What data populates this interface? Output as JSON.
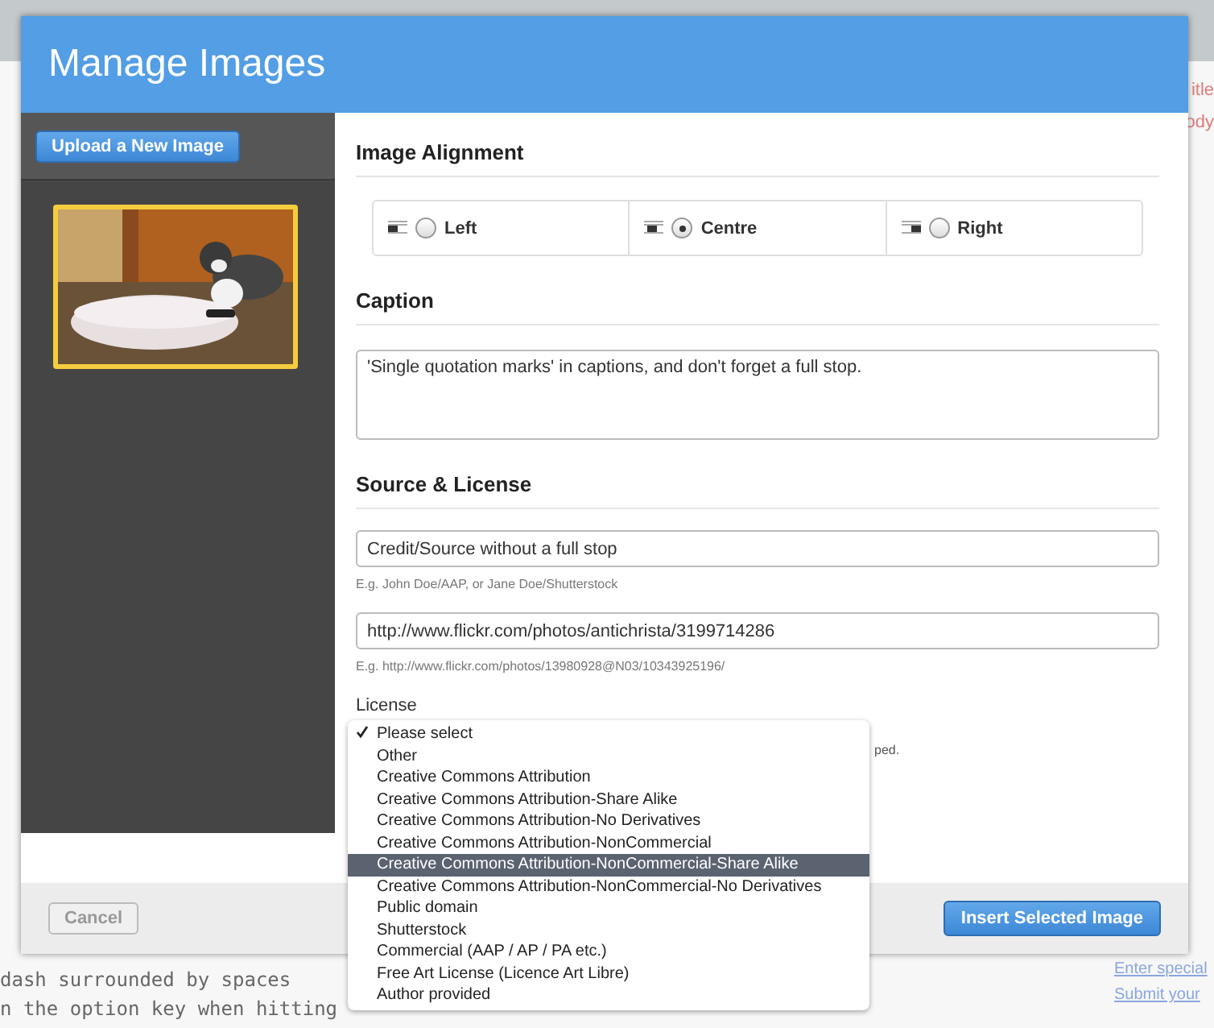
{
  "background": {
    "side_labels": [
      "itle",
      "ody"
    ],
    "lines": [
      "dash surrounded by spaces",
      "n the option key when hitting"
    ],
    "links": [
      "Enter special",
      "Submit your"
    ]
  },
  "dialog": {
    "title": "Manage Images",
    "upload_button": "Upload a New Image",
    "thumbnails": [
      {
        "kind": "picture",
        "selected": true
      }
    ],
    "alignment": {
      "heading": "Image Alignment",
      "options": [
        {
          "label": "Left",
          "kind": "left",
          "selected": false
        },
        {
          "label": "Centre",
          "kind": "centre",
          "selected": true
        },
        {
          "label": "Right",
          "kind": "right",
          "selected": false
        }
      ]
    },
    "caption": {
      "heading": "Caption",
      "value": "'Single quotation marks' in captions, and don't forget a full stop."
    },
    "source": {
      "heading": "Source & License",
      "credit": {
        "value": "Credit/Source without a full stop",
        "hint": "E.g. John Doe/AAP, or Jane Doe/Shutterstock"
      },
      "url": {
        "value": "http://www.flickr.com/photos/antichrista/3199714286",
        "hint": "E.g. http://www.flickr.com/photos/13980928@N03/10343925196/"
      },
      "license_label": "License",
      "license_hint": "ped.",
      "license_options": [
        {
          "label": "Please select",
          "checked": true,
          "highlighted": false
        },
        {
          "label": "Other",
          "checked": false,
          "highlighted": false
        },
        {
          "label": "Creative Commons Attribution",
          "checked": false,
          "highlighted": false
        },
        {
          "label": "Creative Commons Attribution-Share Alike",
          "checked": false,
          "highlighted": false
        },
        {
          "label": "Creative Commons Attribution-No Derivatives",
          "checked": false,
          "highlighted": false
        },
        {
          "label": "Creative Commons Attribution-NonCommercial",
          "checked": false,
          "highlighted": false
        },
        {
          "label": "Creative Commons Attribution-NonCommercial-Share Alike",
          "checked": false,
          "highlighted": true
        },
        {
          "label": "Creative Commons Attribution-NonCommercial-No Derivatives",
          "checked": false,
          "highlighted": false
        },
        {
          "label": "Public domain",
          "checked": false,
          "highlighted": false
        },
        {
          "label": "Shutterstock",
          "checked": false,
          "highlighted": false
        },
        {
          "label": "Commercial (AAP / AP / PA etc.)",
          "checked": false,
          "highlighted": false
        },
        {
          "label": "Free Art License (Licence Art Libre)",
          "checked": false,
          "highlighted": false
        },
        {
          "label": "Author provided",
          "checked": false,
          "highlighted": false
        }
      ]
    },
    "cancel_button": {
      "label": "Cancel",
      "disabled": true
    },
    "insert_button": "Insert Selected Image"
  }
}
